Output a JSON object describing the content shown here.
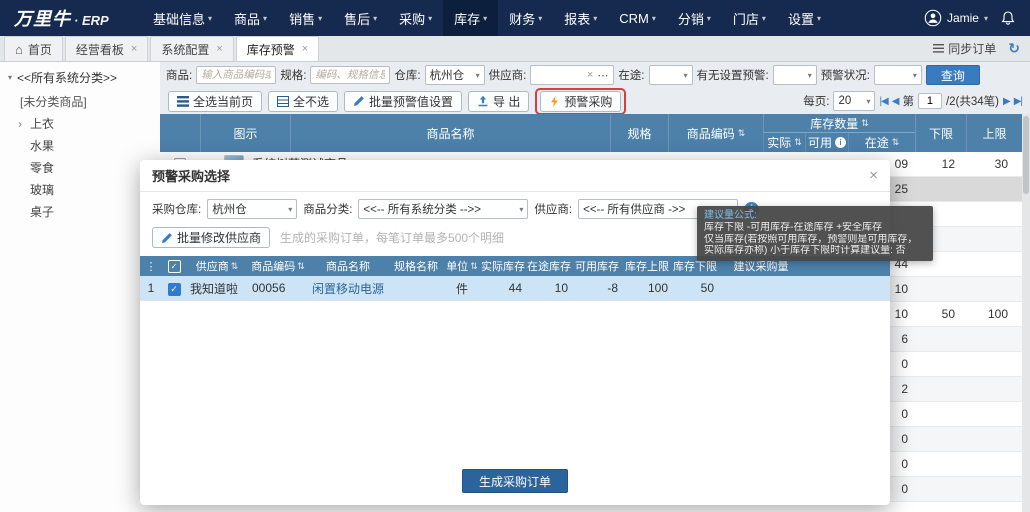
{
  "icons": {
    "caret_down": "▾",
    "home": "⌂",
    "close": "×",
    "refresh": "↻",
    "sort": "⇅",
    "info": "i",
    "dots": "⋯",
    "vdots": "⋮",
    "clear": "×",
    "check": "✓",
    "first_page": "|◀",
    "prev_page": "◀",
    "next_page": "▶",
    "last_page": "▶|",
    "expand": "›"
  },
  "topnav": {
    "logo": "万里牛",
    "logo_suffix": "· ERP",
    "items": [
      "基础信息",
      "商品",
      "销售",
      "售后",
      "采购",
      "库存",
      "财务",
      "报表",
      "CRM",
      "分销",
      "门店",
      "设置"
    ],
    "user": "Jamie"
  },
  "tabbar": {
    "home": "首页",
    "tabs": [
      "经营看板",
      "系统配置",
      "库存预警"
    ],
    "sync": "同步订单"
  },
  "sidebar": {
    "root": "<<所有系统分类>>",
    "items": [
      "[未分类商品]",
      "上衣",
      "水果",
      "零食",
      "玻璃",
      "桌子"
    ]
  },
  "filters": {
    "product_label": "商品:",
    "product_placeholder": "输入商品编码或名称",
    "spec_label": "规格:",
    "spec_placeholder": "编码、规格信息查询",
    "warehouse_label": "仓库:",
    "warehouse_value": "杭州仓",
    "supplier_label": "供应商:",
    "transit_label": "在途:",
    "has_alert_label": "有无设置预警:",
    "status_label": "预警状况:",
    "search": "查询"
  },
  "toolbar": {
    "select_all_page": "全选当前页",
    "select_none": "全不选",
    "batch_alert": "批量预警值设置",
    "export": "导 出",
    "alert_purchase": "预警采购",
    "per_page_label": "每页:",
    "per_page": "20",
    "page_prefix": "第",
    "page": "1",
    "page_suffix": "/2(共34笔)"
  },
  "grid": {
    "headers": {
      "image": "图示",
      "name": "商品名称",
      "spec": "规格",
      "code": "商品编码",
      "qty": "库存数量",
      "actual": "实际",
      "available": "可用",
      "transit": "在途",
      "lower": "下限",
      "upper": "上限"
    },
    "rows": [
      {
        "name": "系统树莓测试商品",
        "transit": "09",
        "lower": "12",
        "upper": "30"
      },
      {
        "transit": "25"
      },
      {},
      {},
      {
        "transit": "44"
      },
      {
        "transit": "10"
      },
      {
        "transit": "10",
        "lower": "50",
        "upper": "100"
      },
      {
        "transit": "6"
      },
      {
        "transit": "0"
      },
      {
        "transit": "2"
      },
      {
        "transit": "0"
      },
      {
        "transit": "0"
      },
      {
        "transit": "0"
      },
      {
        "transit": "0"
      }
    ]
  },
  "modal": {
    "title": "预警采购选择",
    "warehouse_label": "采购仓库:",
    "warehouse_value": "杭州仓",
    "category_label": "商品分类:",
    "category_value": "<<-- 所有系统分类 -->>",
    "supplier_label": "供应商:",
    "supplier_value": "<<-- 所有供应商 ->>",
    "batch_modify": "批量修改供应商",
    "hint": "生成的采购订单，每笔订单最多500个明细",
    "headers": [
      "供应商",
      "商品编码",
      "商品名称",
      "规格名称",
      "单位",
      "实际库存",
      "在途库存",
      "可用库存",
      "库存上限",
      "库存下限",
      "建议采购量"
    ],
    "row": {
      "index": "1",
      "supplier": "我知道啦",
      "code": "00056",
      "name": "闲置移动电源",
      "spec": "",
      "unit": "件",
      "actual": "44",
      "transit": "10",
      "available": "-8",
      "upper": "100",
      "lower": "50",
      "suggest": ""
    },
    "submit": "生成采购订单"
  },
  "tooltip": {
    "title": "建议量公式:",
    "line1": "库存下限 -可用库存-在途库存 +安全库存",
    "line2": "仅当库存(若按照可用库存，预警则是可用库存，",
    "line3": "实际库存亦称) 小于库存下限时计算建议量: 否"
  }
}
